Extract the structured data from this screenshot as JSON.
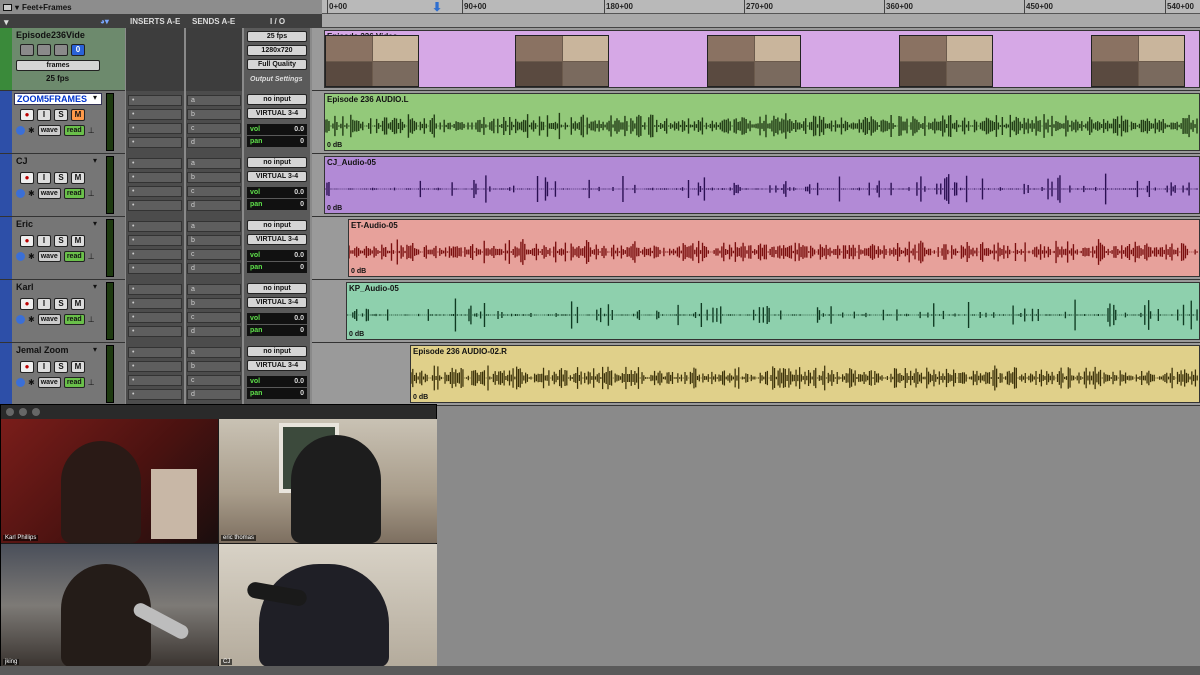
{
  "ruler": {
    "time_format": "Feet+Frames",
    "ticks": [
      "0+00",
      "90+00",
      "180+00",
      "270+00",
      "360+00",
      "450+00",
      "540+00"
    ]
  },
  "columns": {
    "inserts": "INSERTS A-E",
    "sends": "SENDS A-E",
    "io": "I / O"
  },
  "video_track": {
    "name": "Episode236Vide",
    "frames_button": "frames",
    "fps_label": "25 fps",
    "io": [
      "25 fps",
      "1280x720",
      "Full Quality"
    ],
    "output_settings": "Output Settings",
    "clip_label": "Episode 236 Video"
  },
  "tracks": [
    {
      "name": "ZOOM5FRAMES",
      "selected": true,
      "color": "#2d4fa8",
      "io_in": "no input",
      "io_out": "VIRTUAL 3-4",
      "vol": "0.0",
      "pan": "0",
      "clip_label": "Episode 236 AUDIO.L",
      "gain": "0 dB",
      "clip_color": "#93c97a",
      "wave_color": "#203a14"
    },
    {
      "name": "CJ",
      "selected": false,
      "color": "#2d4fa8",
      "io_in": "no input",
      "io_out": "VIRTUAL 3-4",
      "vol": "0.0",
      "pan": "0",
      "clip_label": "CJ_Audio-05",
      "gain": "0 dB",
      "clip_color": "#b28ad6",
      "wave_color": "#2a0f52"
    },
    {
      "name": "Eric",
      "selected": false,
      "color": "#2d4fa8",
      "io_in": "no input",
      "io_out": "VIRTUAL 3-4",
      "vol": "0.0",
      "pan": "0",
      "clip_label": "ET-Audio-05",
      "gain": "0 dB",
      "clip_color": "#e7a19b",
      "wave_color": "#7a0e0e"
    },
    {
      "name": "Karl",
      "selected": false,
      "color": "#2d4fa8",
      "io_in": "no input",
      "io_out": "VIRTUAL 3-4",
      "vol": "0.0",
      "pan": "0",
      "clip_label": "KP_Audio-05",
      "gain": "0 dB",
      "clip_color": "#8ed0ad",
      "wave_color": "#0f3a22"
    },
    {
      "name": "Jemal Zoom",
      "selected": false,
      "color": "#2d4fa8",
      "io_in": "no input",
      "io_out": "VIRTUAL 3-4",
      "vol": "0.0",
      "pan": "0",
      "clip_label": "Episode 236 AUDIO-02.R",
      "gain": "0 dB",
      "clip_color": "#e0d08a",
      "wave_color": "#3a3008"
    }
  ],
  "track_buttons": {
    "rec": "●",
    "input": "I",
    "solo": "S",
    "mute": "M",
    "wave": "wave",
    "read": "read"
  },
  "labels": {
    "vol": "vol",
    "pan": "pan"
  },
  "insert_slots": [
    "a",
    "b",
    "c",
    "d"
  ],
  "zoom": {
    "participants": [
      "Karl Phillips",
      "eric thomas",
      "jking",
      "CJ"
    ]
  }
}
